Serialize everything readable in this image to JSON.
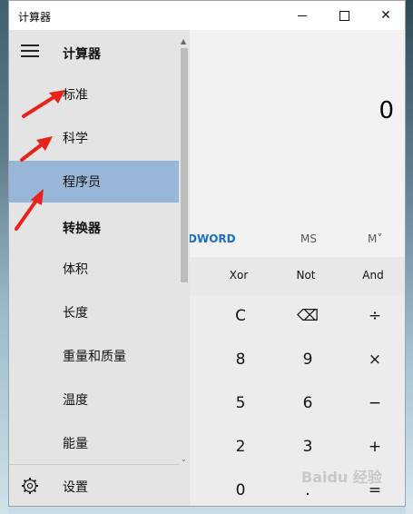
{
  "window": {
    "title": "计算器"
  },
  "nav": {
    "heading_calculator": "计算器",
    "items_calc": [
      {
        "label": "标准"
      },
      {
        "label": "科学"
      },
      {
        "label": "程序员",
        "selected": true
      }
    ],
    "heading_converter": "转换器",
    "items_conv": [
      {
        "label": "体积"
      },
      {
        "label": "长度"
      },
      {
        "label": "重量和质量"
      },
      {
        "label": "温度"
      },
      {
        "label": "能量"
      }
    ],
    "settings_label": "设置"
  },
  "display": {
    "value": "0"
  },
  "word_row": {
    "word_label": "DWORD",
    "ms": "MS",
    "mplus": "M˅"
  },
  "bit_ops": [
    "Xor",
    "Not",
    "And"
  ],
  "keys": [
    [
      "C",
      "⌫",
      "÷"
    ],
    [
      "8",
      "9",
      "×"
    ],
    [
      "5",
      "6",
      "−"
    ],
    [
      "2",
      "3",
      "+"
    ],
    [
      "0",
      ".",
      "="
    ]
  ],
  "watermark": "Baidu 经验",
  "colors": {
    "selected_nav": "#98b6d8",
    "accent": "#1a6fc4",
    "arrow": "#e8231c"
  }
}
